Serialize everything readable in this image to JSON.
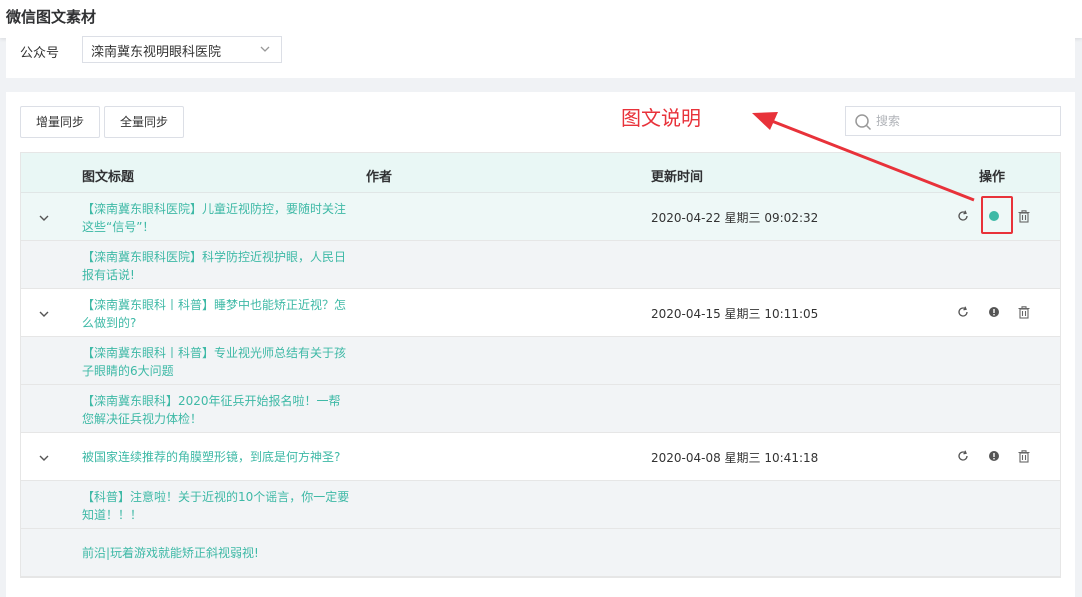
{
  "page": {
    "title": "微信图文素材"
  },
  "filter": {
    "label": "公众号",
    "selected": "滦南冀东视明眼科医院"
  },
  "toolbar": {
    "incremental_sync": "增量同步",
    "full_sync": "全量同步"
  },
  "annotation": {
    "text": "图文说明",
    "color": "#e8323a"
  },
  "search": {
    "placeholder": "搜索"
  },
  "table": {
    "headers": {
      "title": "图文标题",
      "author": "作者",
      "updated": "更新时间",
      "ops": "操作"
    },
    "groups": [
      {
        "main": {
          "title": "【滦南冀东眼科医院】儿童近视防控，要随时关注这些“信号”！",
          "time": "2020-04-22 星期三 09:02:32",
          "status": "published"
        },
        "subs": [
          "【滦南冀东眼科医院】科学防控近视护眼，人民日报有话说!"
        ]
      },
      {
        "main": {
          "title": "【滦南冀东眼科丨科普】睡梦中也能矫正近视？怎么做到的?",
          "time": "2020-04-15 星期三 10:11:05",
          "status": "info"
        },
        "subs": [
          "【滦南冀东眼科丨科普】专业视光师总结有关于孩子眼睛的6大问题",
          "【滦南冀东眼科】2020年征兵开始报名啦！一帮您解决征兵视力体检！"
        ]
      },
      {
        "main": {
          "title": "被国家连续推荐的角膜塑形镜，到底是何方神圣?",
          "time": "2020-04-08 星期三 10:41:18",
          "status": "info"
        },
        "subs": [
          "【科普】注意啦！关于近视的10个谣言，你一定要知道！！！",
          "前沿|玩着游戏就能矫正斜视弱视!"
        ]
      }
    ]
  },
  "colors": {
    "accent": "#3eb9a6",
    "header_bg": "#e9f7f5",
    "highlight": "#e8323a"
  },
  "icons": {
    "refresh": "refresh-icon",
    "status_published": "dot-icon",
    "status_info": "info-icon",
    "delete": "trash-icon",
    "expand": "chevron-down-icon",
    "search": "search-icon"
  }
}
